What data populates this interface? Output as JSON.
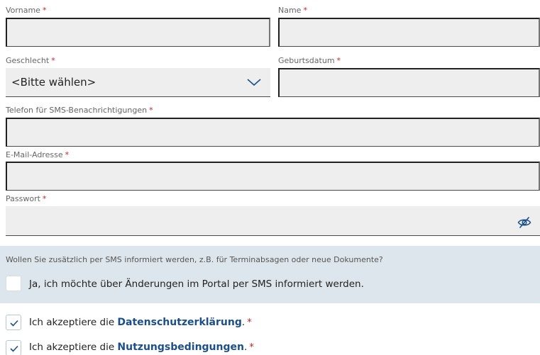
{
  "form": {
    "required_marker": "*",
    "first_name": {
      "label": "Vorname",
      "value": ""
    },
    "last_name": {
      "label": "Name",
      "value": ""
    },
    "gender": {
      "label": "Geschlecht",
      "selected": "<Bitte wählen>",
      "icon": "chevron-down-icon"
    },
    "birthdate": {
      "label": "Geburtsdatum",
      "value": ""
    },
    "phone": {
      "label": "Telefon für SMS-Benachrichtigungen",
      "value": ""
    },
    "email": {
      "label": "E-Mail-Adresse",
      "value": ""
    },
    "password": {
      "label": "Passwort",
      "value": "",
      "icon": "eye-slash-icon"
    }
  },
  "sms": {
    "question": "Wollen Sie zusätzlich per SMS informiert werden, z.B. für Terminabsagen oder neue Dokumente?",
    "option_label": "Ja, ich möchte über Änderungen im Portal per SMS informiert werden.",
    "checked": false
  },
  "consents": [
    {
      "prefix": "Ich akzeptiere die ",
      "link": "Datenschutzerklärung",
      "suffix": ".",
      "checked": true
    },
    {
      "prefix": "Ich akzeptiere die ",
      "link": "Nutzungsbedingungen",
      "suffix": ".",
      "checked": true
    }
  ],
  "colors": {
    "accent": "#1b4f8a",
    "required": "#c0262d",
    "field_bg": "#eeeeee",
    "sms_box_bg": "#dde6ed"
  }
}
